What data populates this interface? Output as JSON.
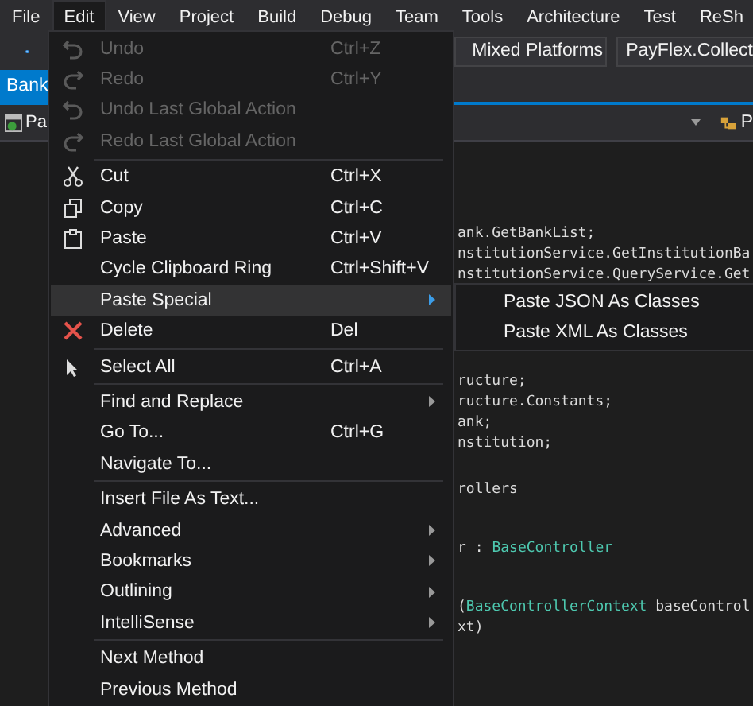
{
  "menubar": [
    {
      "label": "File",
      "selected": false
    },
    {
      "label": "Edit",
      "selected": true
    },
    {
      "label": "View",
      "selected": false
    },
    {
      "label": "Project",
      "selected": false
    },
    {
      "label": "Build",
      "selected": false
    },
    {
      "label": "Debug",
      "selected": false
    },
    {
      "label": "Team",
      "selected": false
    },
    {
      "label": "Tools",
      "selected": false
    },
    {
      "label": "Architecture",
      "selected": false
    },
    {
      "label": "Test",
      "selected": false
    },
    {
      "label": "ReSh",
      "selected": false
    }
  ],
  "toolbar": {
    "platform_dropdown": "Mixed Platforms",
    "project_dropdown": "PayFlex.Collect"
  },
  "document_tab": {
    "label": "Bank",
    "selected": true
  },
  "navigation_bar": {
    "left_text": "Pa",
    "right_text": "P"
  },
  "code_blocks": [
    [
      {
        "segments": [
          {
            "text": "ank.GetBankList;",
            "kind": "plain"
          }
        ]
      },
      {
        "segments": [
          {
            "text": "nstitutionService.GetInstitutionBa",
            "kind": "plain"
          }
        ]
      },
      {
        "segments": [
          {
            "text": "nstitutionService.QueryService.Get",
            "kind": "plain"
          }
        ]
      }
    ],
    [
      {
        "segments": [
          {
            "text": "ructure;",
            "kind": "plain"
          }
        ]
      },
      {
        "segments": [
          {
            "text": "ructure.Constants;",
            "kind": "plain"
          }
        ]
      },
      {
        "segments": [
          {
            "text": "ank;",
            "kind": "plain"
          }
        ]
      },
      {
        "segments": [
          {
            "text": "nstitution;",
            "kind": "plain"
          }
        ]
      }
    ],
    [
      {
        "segments": [
          {
            "text": "rollers",
            "kind": "plain"
          }
        ]
      }
    ],
    [
      {
        "segments": [
          {
            "text": "r : ",
            "kind": "plain"
          },
          {
            "text": "BaseController",
            "kind": "type"
          }
        ]
      }
    ],
    [
      {
        "segments": [
          {
            "text": "(",
            "kind": "plain"
          },
          {
            "text": "BaseControllerContext",
            "kind": "type"
          },
          {
            "text": " baseControl",
            "kind": "plain"
          }
        ]
      },
      {
        "segments": [
          {
            "text": "xt)",
            "kind": "plain"
          }
        ]
      }
    ]
  ],
  "edit_menu": {
    "sections": [
      [
        {
          "label": "Undo",
          "shortcut": "Ctrl+Z",
          "disabled": true,
          "selected": false,
          "submenu": false
        },
        {
          "label": "Redo",
          "shortcut": "Ctrl+Y",
          "disabled": true,
          "selected": false,
          "submenu": false
        },
        {
          "label": "Undo Last Global Action",
          "disabled": true,
          "selected": false,
          "submenu": false
        },
        {
          "label": "Redo Last Global Action",
          "disabled": true,
          "selected": false,
          "submenu": false
        }
      ],
      [
        {
          "label": "Cut",
          "shortcut": "Ctrl+X",
          "disabled": false,
          "selected": false,
          "submenu": false
        },
        {
          "label": "Copy",
          "shortcut": "Ctrl+C",
          "disabled": false,
          "selected": false,
          "submenu": false
        },
        {
          "label": "Paste",
          "shortcut": "Ctrl+V",
          "disabled": false,
          "selected": false,
          "submenu": false
        },
        {
          "label": "Cycle Clipboard Ring",
          "shortcut": "Ctrl+Shift+V",
          "disabled": false,
          "selected": false,
          "submenu": false
        },
        {
          "label": "Paste Special",
          "disabled": false,
          "selected": true,
          "submenu": true
        },
        {
          "label": "Delete",
          "shortcut": "Del",
          "disabled": false,
          "selected": false,
          "submenu": false
        }
      ],
      [
        {
          "label": "Select All",
          "shortcut": "Ctrl+A",
          "disabled": false,
          "selected": false,
          "submenu": false
        }
      ],
      [
        {
          "label": "Find and Replace",
          "disabled": false,
          "selected": false,
          "submenu": true
        },
        {
          "label": "Go To...",
          "shortcut": "Ctrl+G",
          "disabled": false,
          "selected": false,
          "submenu": false
        },
        {
          "label": "Navigate To...",
          "disabled": false,
          "selected": false,
          "submenu": false
        }
      ],
      [
        {
          "label": "Insert File As Text...",
          "disabled": false,
          "selected": false,
          "submenu": false
        },
        {
          "label": "Advanced",
          "disabled": false,
          "selected": false,
          "submenu": true
        },
        {
          "label": "Bookmarks",
          "disabled": false,
          "selected": false,
          "submenu": true
        },
        {
          "label": "Outlining",
          "disabled": false,
          "selected": false,
          "submenu": true
        },
        {
          "label": "IntelliSense",
          "disabled": false,
          "selected": false,
          "submenu": true
        }
      ],
      [
        {
          "label": "Next Method",
          "disabled": false,
          "selected": false,
          "submenu": false
        },
        {
          "label": "Previous Method",
          "disabled": false,
          "selected": false,
          "submenu": false
        }
      ]
    ]
  },
  "paste_special_submenu": [
    {
      "label": "Paste JSON As Classes",
      "selected": false
    },
    {
      "label": "Paste XML As Classes",
      "selected": false
    }
  ]
}
